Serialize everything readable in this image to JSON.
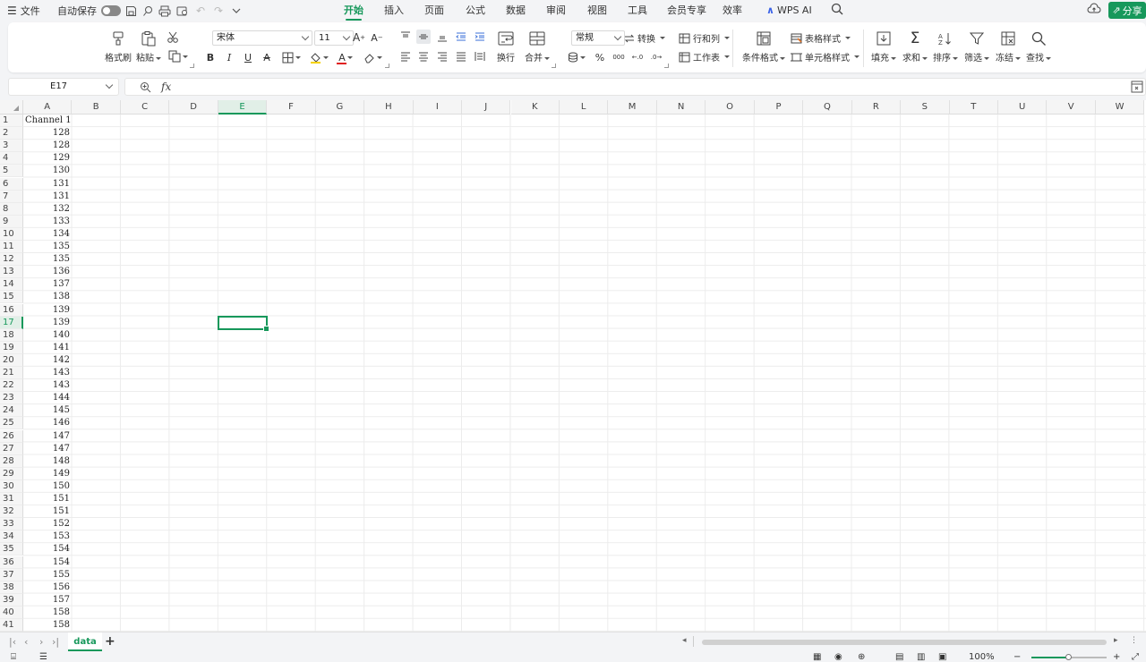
{
  "menu": {
    "file_label": "文件",
    "autosave_label": "自动保存",
    "tabs": [
      "开始",
      "插入",
      "页面",
      "公式",
      "数据",
      "审阅",
      "视图",
      "工具",
      "会员专享",
      "效率",
      "WPS AI"
    ],
    "active_tab": "开始",
    "share_label": "分享"
  },
  "ribbon": {
    "format_painter": "格式刷",
    "paste": "粘贴",
    "font_name": "宋体",
    "font_size": "11",
    "wrap": "换行",
    "merge": "合并",
    "number_format": "常规",
    "convert": "转换",
    "rows_cols": "行和列",
    "worksheet": "工作表",
    "cond_format": "条件格式",
    "table_style": "表格样式",
    "cell_style": "单元格样式",
    "fill": "填充",
    "sum": "求和",
    "sort": "排序",
    "filter": "筛选",
    "freeze": "冻结",
    "find": "查找",
    "bold": "B",
    "italic": "I",
    "underline": "U",
    "strike": "A",
    "font_color": "A",
    "percent": "%",
    "thousands": "000"
  },
  "formula_bar": {
    "name_box": "E17",
    "fx": "fx",
    "value": ""
  },
  "grid": {
    "columns": [
      "A",
      "B",
      "C",
      "D",
      "E",
      "F",
      "G",
      "H",
      "I",
      "J",
      "K",
      "L",
      "M",
      "N",
      "O",
      "P",
      "Q",
      "R",
      "S",
      "T",
      "U",
      "V",
      "W"
    ],
    "selected_column": "E",
    "selected_row": 17,
    "row_numbers": [
      "1",
      "2",
      "3",
      "4",
      "5",
      "6",
      "7",
      "8",
      "9",
      "10",
      "11",
      "12",
      "13",
      "14",
      "15",
      "16",
      "17",
      "18",
      "19",
      "20",
      "21",
      "22",
      "23",
      "24",
      "25",
      "26",
      "27",
      "28",
      "29",
      "30",
      "31",
      "32",
      "33",
      "34",
      "35",
      "36",
      "37",
      "38",
      "39",
      "40",
      "41"
    ],
    "col_a_header": "Channel 1",
    "col_a_values": [
      "128",
      "128",
      "129",
      "130",
      "131",
      "131",
      "132",
      "133",
      "134",
      "135",
      "135",
      "136",
      "137",
      "138",
      "139",
      "139",
      "140",
      "141",
      "142",
      "143",
      "143",
      "144",
      "145",
      "146",
      "147",
      "147",
      "148",
      "149",
      "150",
      "151",
      "151",
      "152",
      "153",
      "154",
      "154",
      "155",
      "156",
      "157",
      "158",
      "158"
    ]
  },
  "sheet_tabs": {
    "tabs": [
      "data"
    ],
    "active": "data",
    "add_label": "+"
  },
  "status_bar": {
    "zoom_label": "100%",
    "zoom_level": 0.5
  },
  "colors": {
    "accent": "#17985b",
    "wps_ai": "#3b63e8"
  }
}
